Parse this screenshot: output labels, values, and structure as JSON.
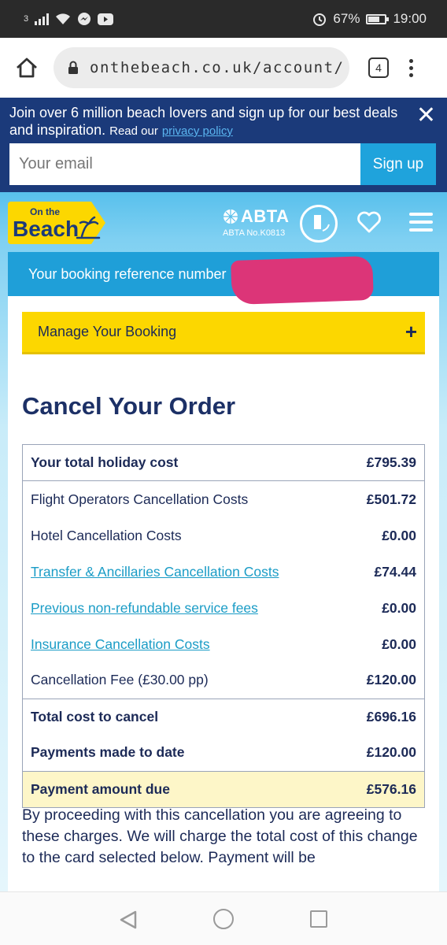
{
  "status_bar": {
    "left_text": "3",
    "battery": "67%",
    "time": "19:00"
  },
  "browser": {
    "url": "onthebeach.co.uk/account/",
    "tab_count": "4"
  },
  "newsletter": {
    "text": "Join over 6 million beach lovers and sign up for our best deals and inspiration.",
    "read_our": "Read our",
    "privacy_link": "privacy policy",
    "email_placeholder": "Your email",
    "signup_label": "Sign up"
  },
  "header": {
    "logo_text": "On the Beach",
    "abta_label": "ABTA",
    "abta_number": "ABTA No.K0813",
    "protected_label": "PROTECTED"
  },
  "booking": {
    "reference_label": "Your booking reference number",
    "manage_label": "Manage Your Booking",
    "manage_icon": "+"
  },
  "cancel": {
    "title": "Cancel Your Order",
    "total_holiday": {
      "label": "Your total holiday cost",
      "amount": "£795.39"
    },
    "items": [
      {
        "label": "Flight Operators Cancellation Costs",
        "amount": "£501.72"
      },
      {
        "label": "Hotel Cancellation Costs",
        "amount": "£0.00"
      },
      {
        "label": "Transfer & Ancillaries Cancellation Costs",
        "amount": "£74.44"
      },
      {
        "label": "Previous non-refundable service fees",
        "amount": "£0.00"
      },
      {
        "label": "Insurance Cancellation Costs",
        "amount": "£0.00"
      },
      {
        "label": "Cancellation Fee (£30.00 pp)",
        "amount": "£120.00"
      }
    ],
    "total_cancel": {
      "label": "Total cost to cancel",
      "amount": "£696.16"
    },
    "payments_made": {
      "label": "Payments made to date",
      "amount": "£120.00"
    },
    "amount_due": {
      "label": "Payment amount due",
      "amount": "£576.16"
    },
    "disclaimer": "By proceeding with this cancellation you are agreeing to these charges. We will charge the total cost of this change to the card selected below. Payment will be"
  },
  "colors": {
    "navy": "#1b3a7a",
    "brand_blue": "#1f9fd8",
    "yellow": "#fcd700",
    "text_dark": "#1c2a57",
    "link": "#1a9cc6",
    "due_bg": "#fdf6c8"
  }
}
